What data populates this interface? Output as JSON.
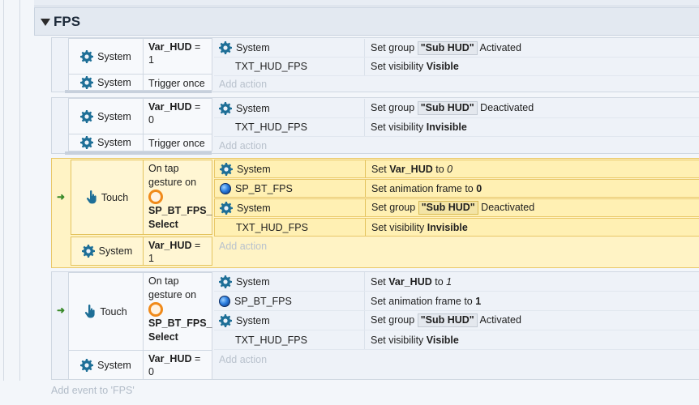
{
  "group": {
    "title": "FPS"
  },
  "events": [
    {
      "conditions": [
        {
          "object": "System",
          "icon": "gear-icon",
          "text_bold": "Var_HUD",
          "text": " = 1"
        },
        {
          "object": "System",
          "icon": "gear-icon",
          "text": "Trigger once"
        }
      ],
      "actions": [
        {
          "object": "System",
          "icon": "gear-icon",
          "pre": "Set group ",
          "pill": "\"Sub HUD\"",
          "post": " Activated"
        },
        {
          "object": "TXT_HUD_FPS",
          "icon": "",
          "pre": "Set visibility ",
          "bold": "Visible"
        }
      ],
      "add_action": "Add action"
    },
    {
      "conditions": [
        {
          "object": "System",
          "icon": "gear-icon",
          "text_bold": "Var_HUD",
          "text": " = 0"
        },
        {
          "object": "System",
          "icon": "gear-icon",
          "text": "Trigger once"
        }
      ],
      "actions": [
        {
          "object": "System",
          "icon": "gear-icon",
          "pre": "Set group ",
          "pill": "\"Sub HUD\"",
          "post": " Deactivated"
        },
        {
          "object": "TXT_HUD_FPS",
          "icon": "",
          "pre": "Set visibility ",
          "bold": "Invisible"
        }
      ],
      "add_action": "Add action"
    },
    {
      "selected": true,
      "conditions": [
        {
          "object": "Touch",
          "icon": "touch-hand-icon",
          "text_a": "On tap gesture on",
          "target": "SP_BT_FPS_ Select"
        },
        {
          "object": "System",
          "icon": "gear-icon",
          "text_bold": "Var_HUD",
          "text": " = 1"
        }
      ],
      "actions": [
        {
          "object": "System",
          "icon": "gear-icon",
          "pre": "Set ",
          "bold": "Var_HUD",
          "post": " to ",
          "italic": "0"
        },
        {
          "object": "SP_BT_FPS",
          "icon": "sprite-orb-icon",
          "pre": "Set animation frame to ",
          "bold": "0"
        },
        {
          "object": "System",
          "icon": "gear-icon",
          "pre": "Set group ",
          "pill": "\"Sub HUD\"",
          "post": " Deactivated"
        },
        {
          "object": "TXT_HUD_FPS",
          "icon": "",
          "pre": "Set visibility ",
          "bold": "Invisible"
        }
      ],
      "add_action": "Add action"
    },
    {
      "conditions": [
        {
          "object": "Touch",
          "icon": "touch-hand-icon",
          "text_a": "On tap gesture on",
          "target": "SP_BT_FPS_ Select"
        },
        {
          "object": "System",
          "icon": "gear-icon",
          "text_bold": "Var_HUD",
          "text": " = 0"
        }
      ],
      "actions": [
        {
          "object": "System",
          "icon": "gear-icon",
          "pre": "Set ",
          "bold": "Var_HUD",
          "post": " to ",
          "italic": "1"
        },
        {
          "object": "SP_BT_FPS",
          "icon": "sprite-orb-icon",
          "pre": "Set animation frame to ",
          "bold": "1"
        },
        {
          "object": "System",
          "icon": "gear-icon",
          "pre": "Set group ",
          "pill": "\"Sub HUD\"",
          "post": " Activated"
        },
        {
          "object": "TXT_HUD_FPS",
          "icon": "",
          "pre": "Set visibility ",
          "bold": "Visible"
        }
      ],
      "add_action": "Add action"
    }
  ],
  "add_event": "Add event to 'FPS'",
  "colors": {
    "selected_bg": "#fff3c5",
    "selected_border": "#e9c86a",
    "gear": "#1f6f9a",
    "trigger_arrow": "#3a8a2a"
  }
}
